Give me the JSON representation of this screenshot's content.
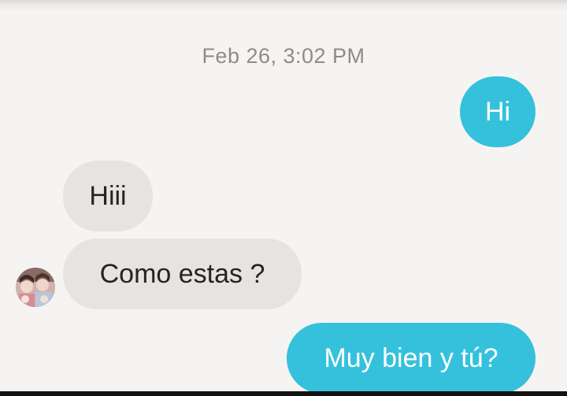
{
  "conversation": {
    "timestamp": "Feb 26, 3:02 PM",
    "messages": [
      {
        "direction": "sent",
        "text": "Hi"
      },
      {
        "direction": "received",
        "text": "Hiii"
      },
      {
        "direction": "received",
        "text": "Como estas ?"
      },
      {
        "direction": "sent",
        "text": "Muy bien y tú?"
      }
    ]
  },
  "colors": {
    "background": "#f6f4f2",
    "sent_bubble": "#35c1dc",
    "received_bubble": "#e6e3e1",
    "timestamp_text": "#8e8b89"
  }
}
